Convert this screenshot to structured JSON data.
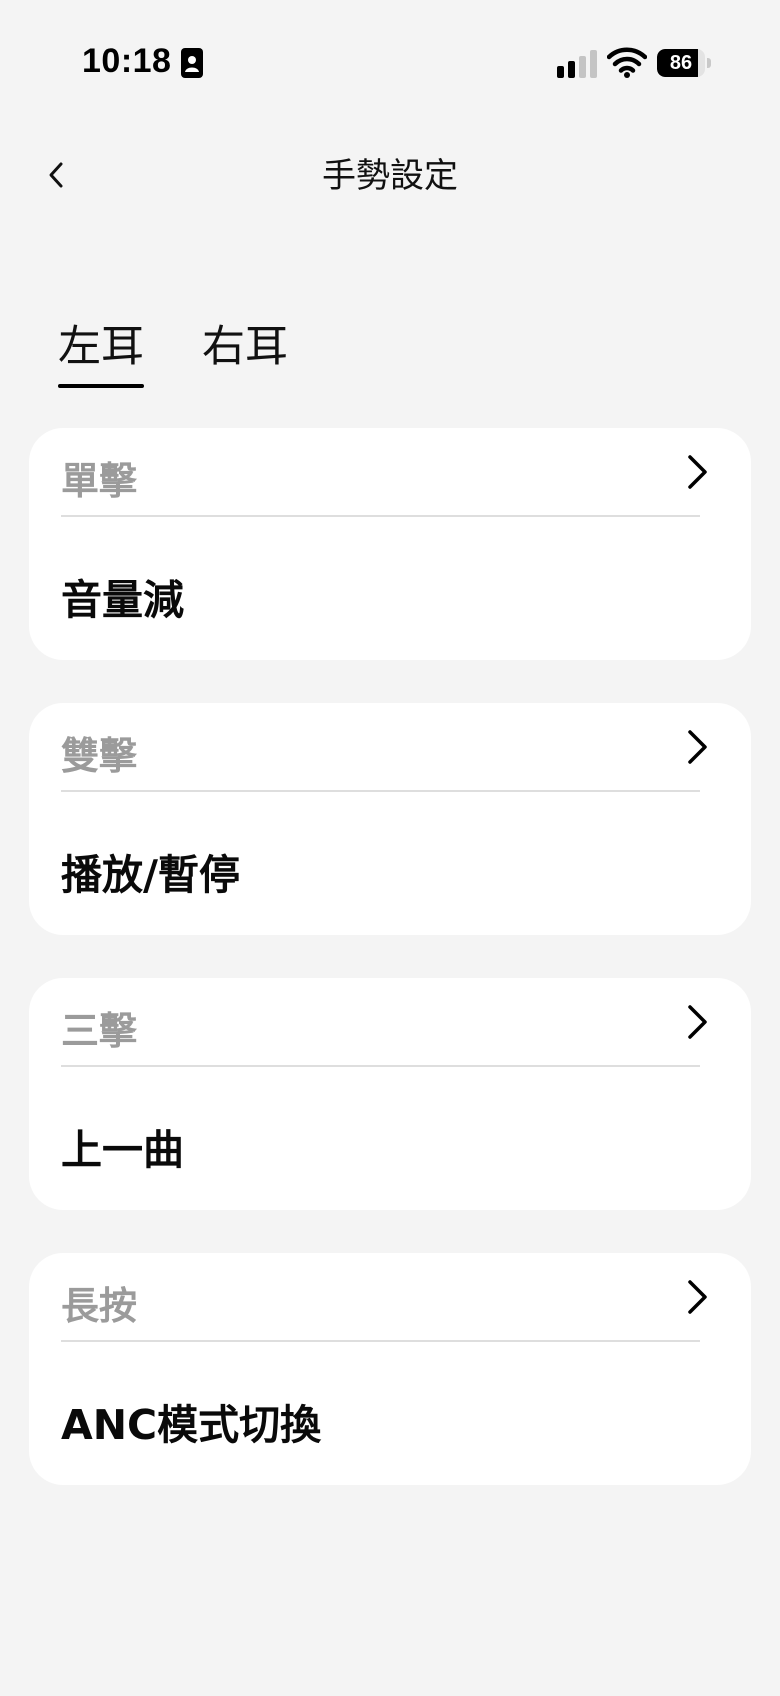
{
  "status_bar": {
    "time": "10:18",
    "battery": "86",
    "battery_level": 0.86
  },
  "header": {
    "title": "手勢設定"
  },
  "tabs": [
    {
      "label": "左耳",
      "selected": true
    },
    {
      "label": "右耳",
      "selected": false
    }
  ],
  "gestures": [
    {
      "label": "單擊",
      "value": "音量減"
    },
    {
      "label": "雙擊",
      "value": "播放/暫停"
    },
    {
      "label": "三擊",
      "value": "上一曲"
    },
    {
      "label": "長按",
      "value": "ANC模式切換"
    }
  ],
  "icons": {
    "back": "chevron-left-icon",
    "row": "chevron-right-icon",
    "status": [
      "id-card-icon",
      "signal-icon",
      "wifi-icon",
      "battery-icon"
    ]
  },
  "colors": {
    "background": "#f4f4f4",
    "card": "#ffffff",
    "label": "#9b9b9b",
    "text": "#111111"
  }
}
